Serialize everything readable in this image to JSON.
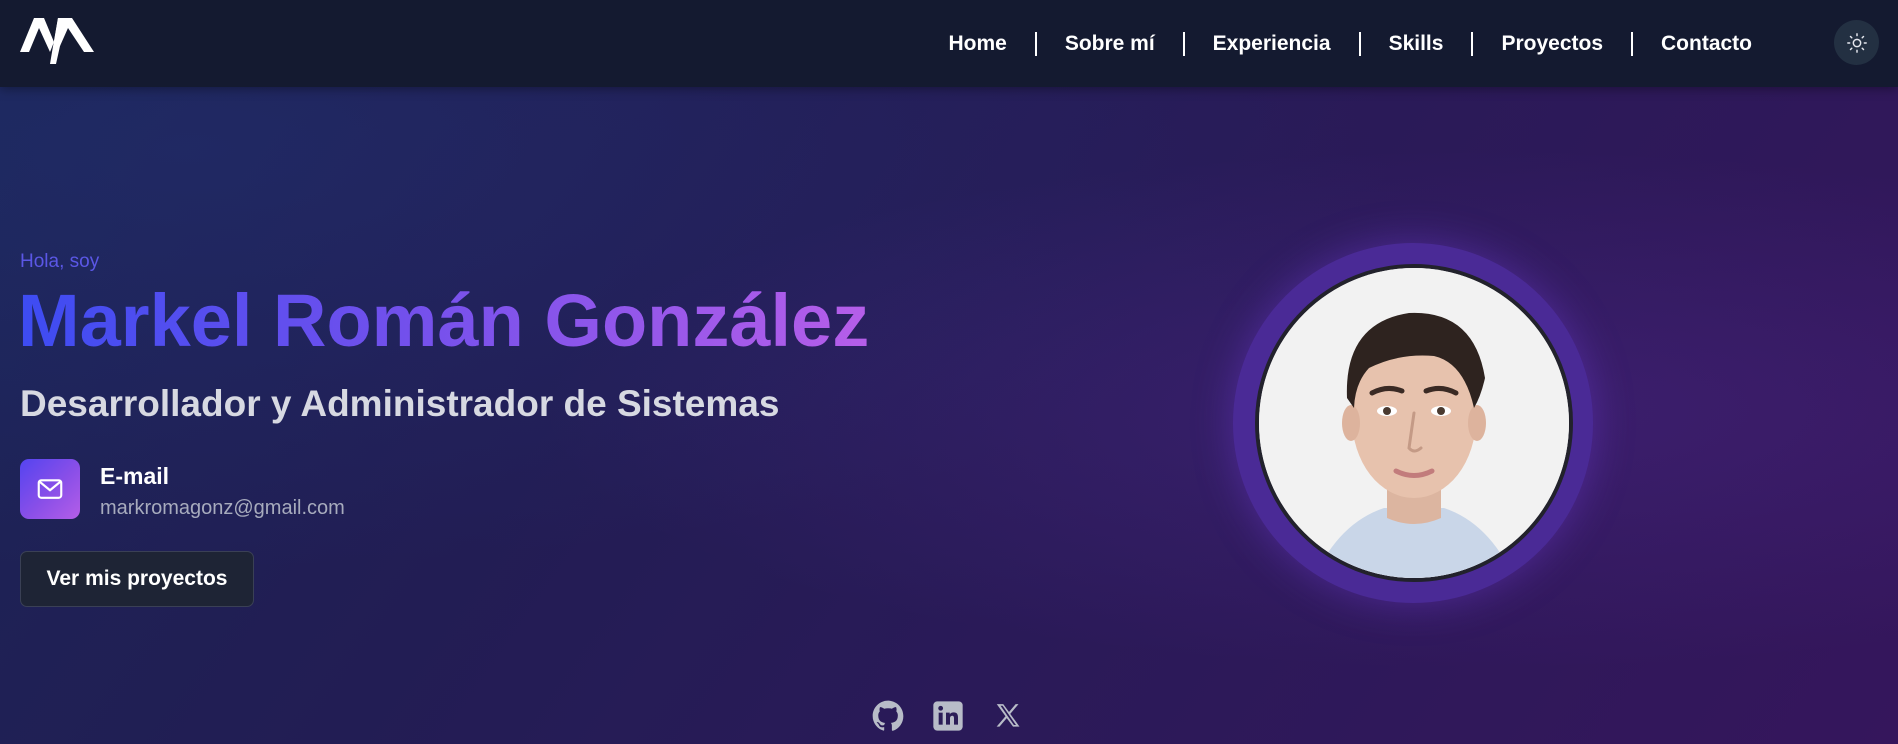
{
  "nav": {
    "logo_text": "MA",
    "items": [
      {
        "label": "Home"
      },
      {
        "label": "Sobre mí"
      },
      {
        "label": "Experiencia"
      },
      {
        "label": "Skills"
      },
      {
        "label": "Proyectos"
      },
      {
        "label": "Contacto"
      }
    ],
    "theme_toggle_icon": "sun-icon"
  },
  "hero": {
    "greeting": "Hola, soy",
    "name": "Markel Román González",
    "role": "Desarrollador y Administrador de Sistemas",
    "email_label": "E-mail",
    "email_value": "markromagonz@gmail.com",
    "email_icon": "mail-icon",
    "cta_label": "Ver mis proyectos"
  },
  "avatar": {
    "icon": "profile-photo"
  },
  "social": [
    {
      "icon": "github-icon"
    },
    {
      "icon": "linkedin-icon"
    },
    {
      "icon": "x-icon"
    }
  ],
  "colors": {
    "accent_blue": "#3d4cf2",
    "accent_purple": "#b65ee9",
    "nav_bg": "#141a30"
  }
}
